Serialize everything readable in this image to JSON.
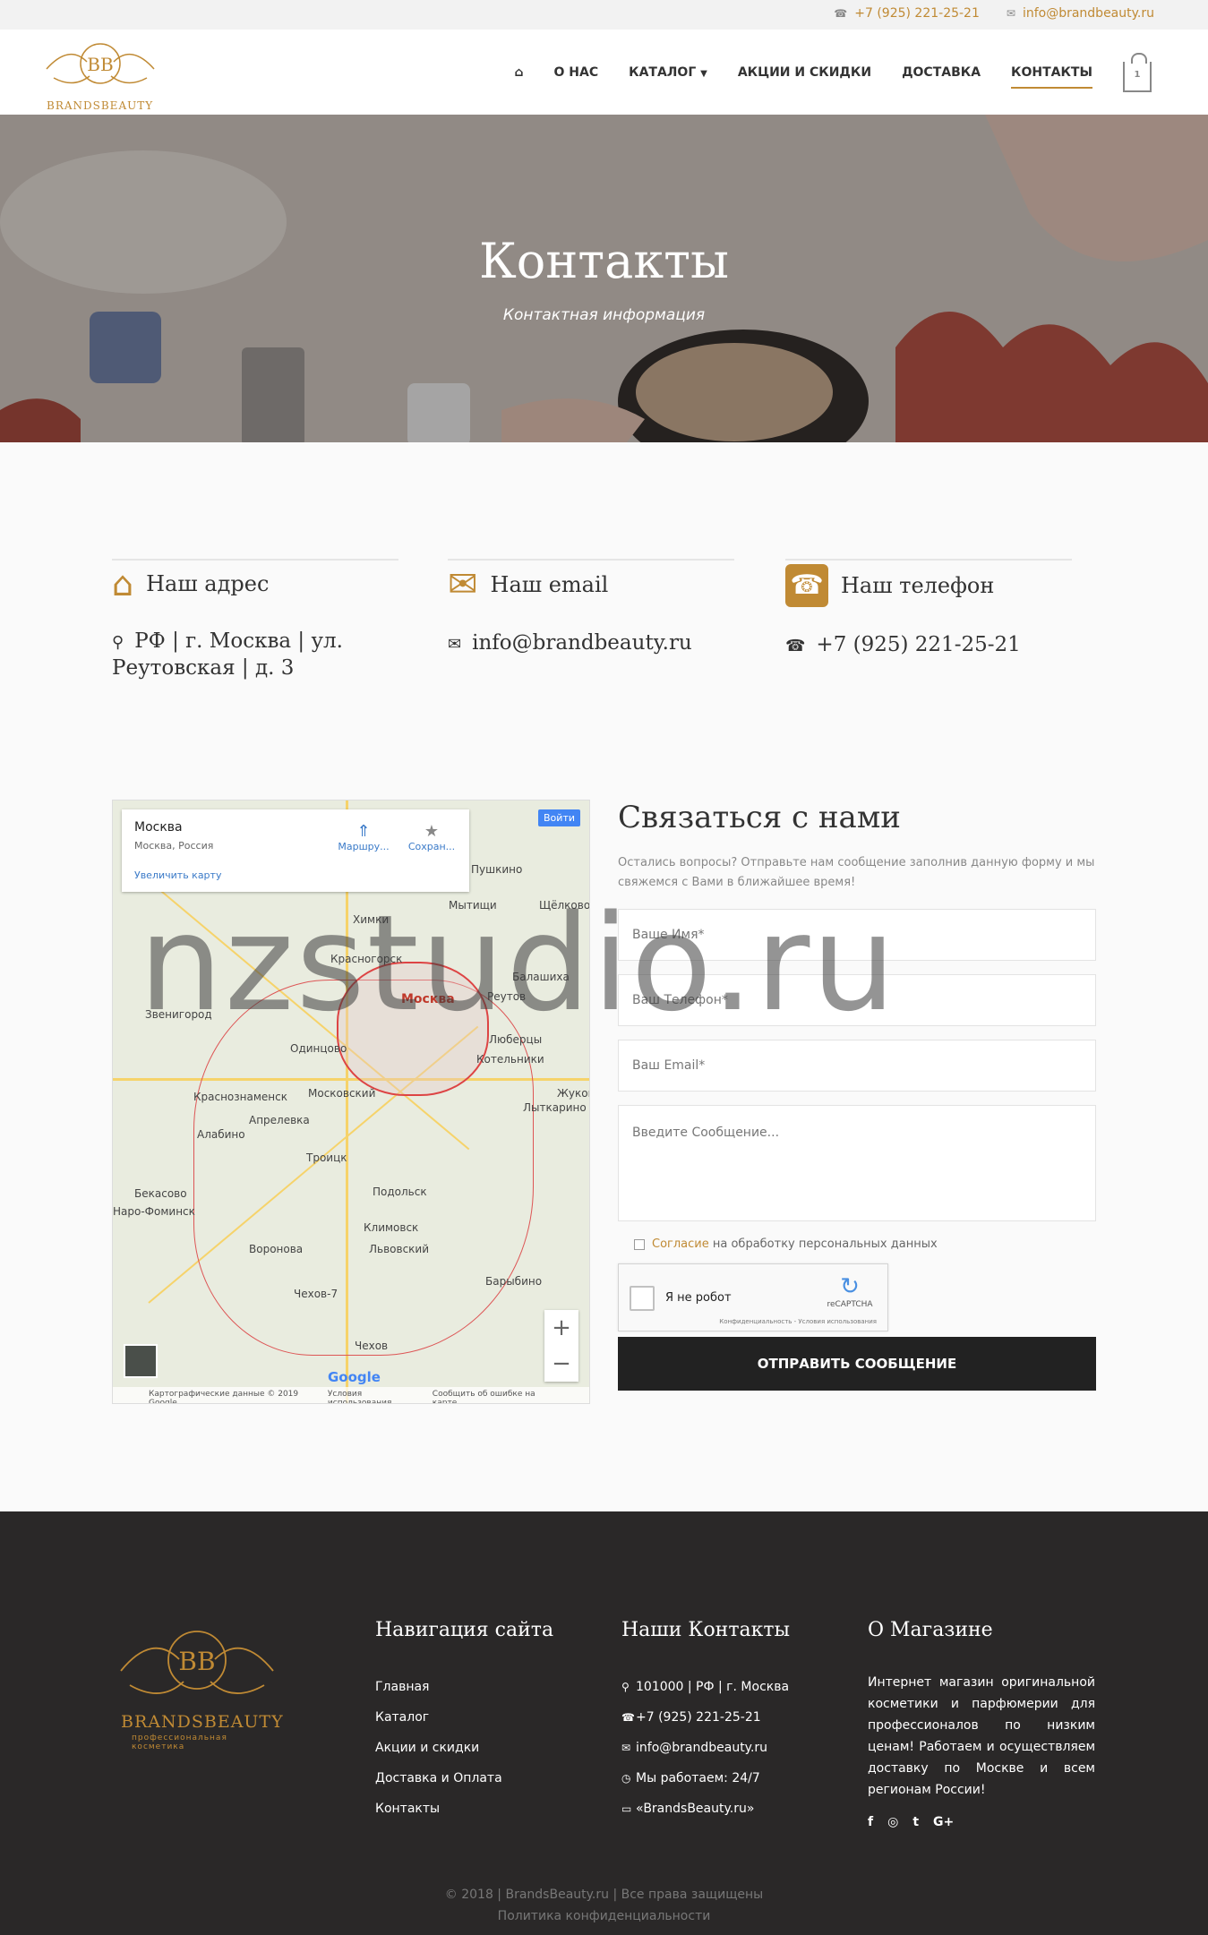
{
  "topbar": {
    "phone": "+7 (925) 221-25-21",
    "email": "info@brandbeauty.ru"
  },
  "logo": {
    "monogram": "BB",
    "brand": "BRANDSBEAUTY"
  },
  "nav": {
    "items": [
      "О НАС",
      "КАТАЛОГ",
      "АКЦИИ И СКИДКИ",
      "ДОСТАВКА",
      "КОНТАКТЫ"
    ],
    "active": "КОНТАКТЫ",
    "cart_count": "1"
  },
  "hero": {
    "title": "Контакты",
    "subtitle": "Контактная информация"
  },
  "info": {
    "address": {
      "title": "Наш адрес",
      "value": "РФ | г. Москва | ул. Реутовская | д. 3"
    },
    "email": {
      "title": "Наш email",
      "value": "info@brandbeauty.ru"
    },
    "phone": {
      "title": "Наш телефон",
      "value": "+7 (925) 221-25-21"
    }
  },
  "map": {
    "place": "Москва",
    "place_sub": "Москва, Россия",
    "zoom_link": "Увеличить карту",
    "route": "Маршру...",
    "save": "Сохран...",
    "signin": "Войти",
    "cities": [
      "Пушкино",
      "Мытищи",
      "Химки",
      "Щёлково",
      "Красногорск",
      "Балашиха",
      "Москва",
      "Реутов",
      "Звенигород",
      "Одинцово",
      "Люберцы",
      "Котельники",
      "Московский",
      "Краснознаменск",
      "Апрелевка",
      "Алабино",
      "Лыткарино",
      "Жуковский",
      "Троицк",
      "Подольск",
      "Бекасово",
      "Наро-Фоминск",
      "Климовск",
      "Воронова",
      "Львовский",
      "Чехов-7",
      "Барыбино",
      "Чехов"
    ],
    "footer": [
      "Картографические данные © 2019 Google",
      "Условия использования",
      "Сообщить об ошибке на карте"
    ],
    "google": "Google"
  },
  "form": {
    "title": "Связаться с нами",
    "desc": "Остались вопросы? Отправьте нам сообщение заполнив данную форму и мы свяжемся с Вами в ближайшее время!",
    "name_ph": "Ваше Имя*",
    "phone_ph": "Ваш Телефон*",
    "email_ph": "Ваш Email*",
    "msg_ph": "Введите Сообщение...",
    "agree_link": "Согласие",
    "agree_text": "на обработку персональных данных",
    "captcha_label": "Я не робот",
    "captcha_brand": "reCAPTCHA",
    "captcha_tos": "Конфиденциальность - Условия использования",
    "submit": "ОТПРАВИТЬ СООБЩЕНИЕ"
  },
  "footer": {
    "brand": "BRANDSBEAUTY",
    "tagline": "профессиональная косметика",
    "nav_title": "Навигация сайта",
    "nav_items": [
      "Главная",
      "Каталог",
      "Акции и скидки",
      "Доставка и Оплата",
      "Контакты"
    ],
    "contacts_title": "Наши Контакты",
    "contacts": [
      "101000 | РФ | г. Москва",
      "+7 (925) 221-25-21",
      "info@brandbeauty.ru",
      "Мы работаем: 24/7",
      "«BrandsBeauty.ru»"
    ],
    "about_title": "О Магазине",
    "about": "Интернет магазин оригинальной косметики и парфюмерии для профессионалов по низким ценам! Работаем и осуществляем доставку по Москве и всем регионам России!",
    "copyright": "© 2018 | BrandsBeauty.ru | Все права защищены",
    "privacy": "Политика конфиденциальности"
  },
  "watermark": "nzstudio.ru",
  "colors": {
    "accent": "#c08a34",
    "dark": "#2a2828"
  }
}
